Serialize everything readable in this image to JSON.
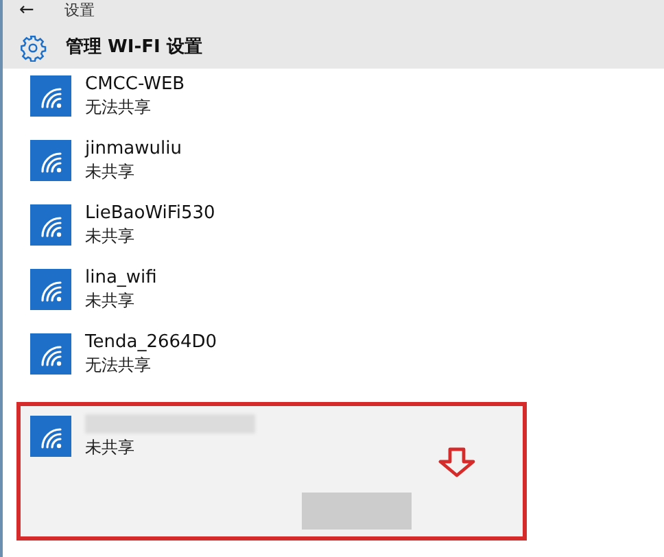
{
  "header": {
    "back": "←",
    "title": "设置"
  },
  "page_title": "管理 WI-FI 设置",
  "networks": [
    {
      "name": "CMCC-WEB",
      "status": "无法共享",
      "name_hidden": false,
      "selected": false
    },
    {
      "name": "jinmawuliu",
      "status": "未共享",
      "name_hidden": false,
      "selected": false
    },
    {
      "name": "LieBaoWiFi530",
      "status": "未共享",
      "name_hidden": false,
      "selected": false
    },
    {
      "name": "lina_wifi",
      "status": "未共享",
      "name_hidden": false,
      "selected": false
    },
    {
      "name": "Tenda_2664D0",
      "status": "无法共享",
      "name_hidden": false,
      "selected": false
    },
    {
      "status": "未共享",
      "name_hidden": true,
      "selected": true
    }
  ]
}
